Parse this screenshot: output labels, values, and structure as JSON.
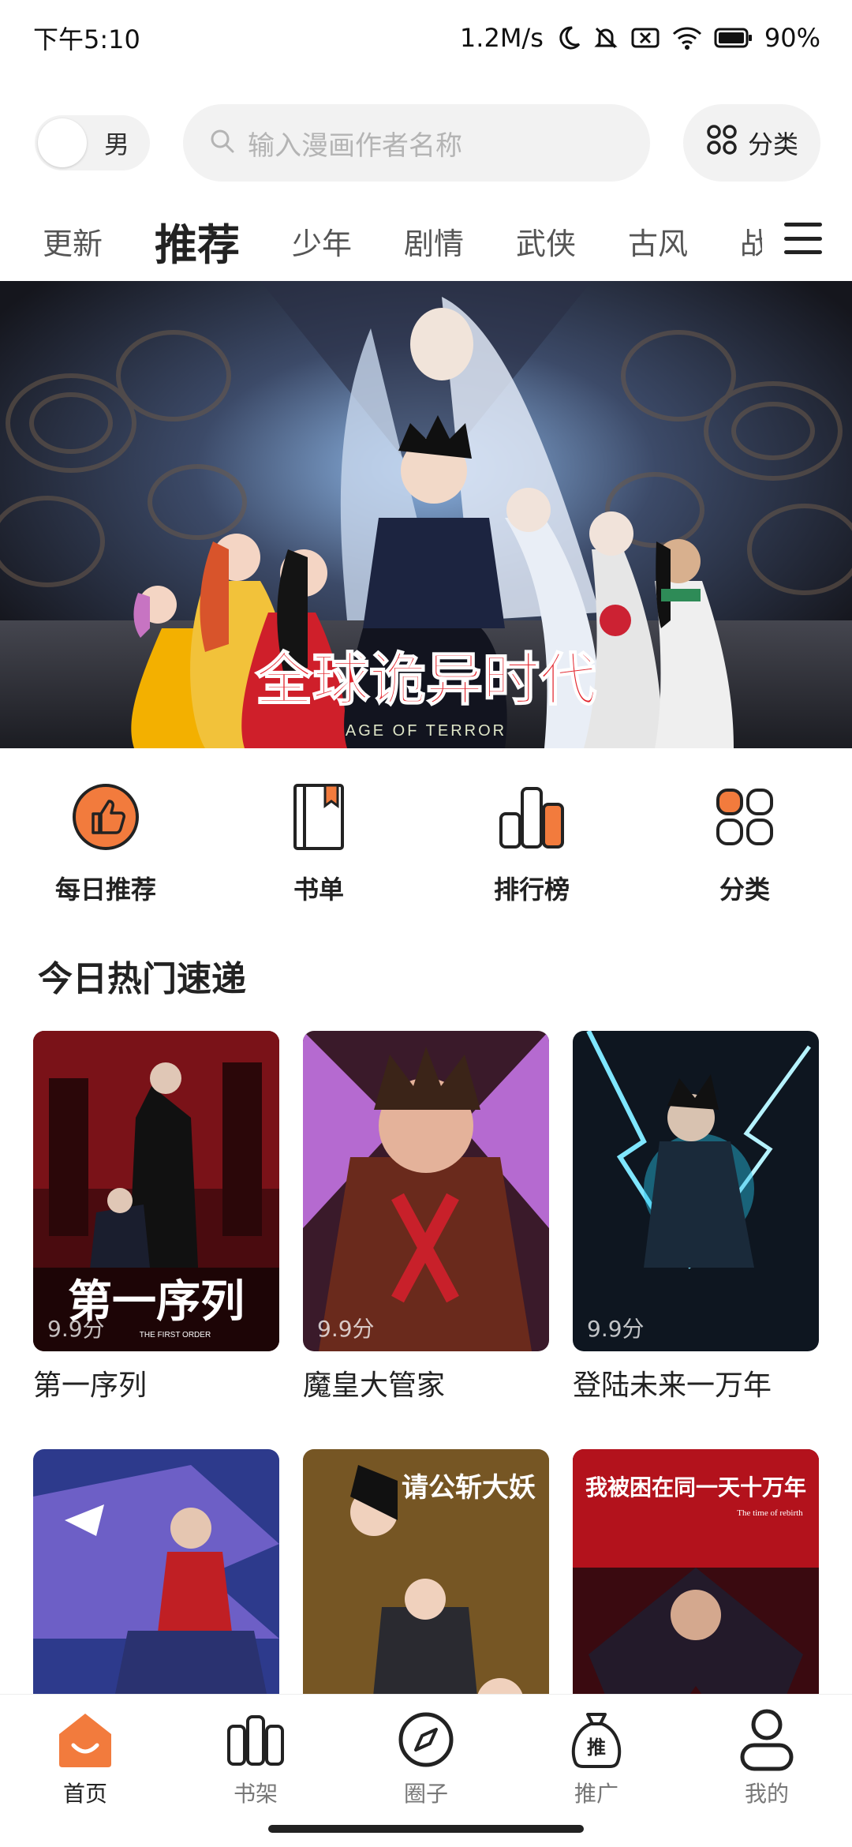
{
  "status_bar": {
    "time": "下午5:10",
    "net_speed": "1.2M/s",
    "battery": "90%"
  },
  "top_bar": {
    "gender_label": "男",
    "search_placeholder": "输入漫画作者名称",
    "category_label": "分类"
  },
  "tabs": [
    {
      "label": "更新",
      "active": false
    },
    {
      "label": "推荐",
      "active": true
    },
    {
      "label": "少年",
      "active": false
    },
    {
      "label": "剧情",
      "active": false
    },
    {
      "label": "武侠",
      "active": false
    },
    {
      "label": "古风",
      "active": false
    },
    {
      "label": "战",
      "active": false
    }
  ],
  "banner": {
    "title": "全球诡异时代",
    "subtitle": "AGE OF TERROR"
  },
  "quick_entries": [
    {
      "label": "每日推荐",
      "icon": "thumbs-up-icon"
    },
    {
      "label": "书单",
      "icon": "book-icon"
    },
    {
      "label": "排行榜",
      "icon": "ranking-icon"
    },
    {
      "label": "分类",
      "icon": "category-icon"
    }
  ],
  "section_title": "今日热门速递",
  "comics": [
    {
      "title": "第一序列",
      "score": "9.9分",
      "cover_text": "第一序列",
      "cover_sub": "THE FIRST ORDER"
    },
    {
      "title": "魔皇大管家",
      "score": "9.9分",
      "cover_text": "",
      "cover_sub": ""
    },
    {
      "title": "登陆未来一万年",
      "score": "9.9分",
      "cover_text": "",
      "cover_sub": ""
    },
    {
      "title": "",
      "score": "",
      "cover_text": "",
      "cover_sub": ""
    },
    {
      "title": "",
      "score": "",
      "cover_text": "请公斩大妖",
      "cover_sub": ""
    },
    {
      "title": "",
      "score": "",
      "cover_text": "我被困在同一天十万年",
      "cover_sub": "The time of rebirth"
    }
  ],
  "bottom_nav": [
    {
      "label": "首页",
      "icon": "home-icon",
      "active": true
    },
    {
      "label": "书架",
      "icon": "bookshelf-icon",
      "active": false
    },
    {
      "label": "圈子",
      "icon": "compass-icon",
      "active": false
    },
    {
      "label": "推广",
      "icon": "promote-bag-icon",
      "active": false
    },
    {
      "label": "我的",
      "icon": "profile-icon",
      "active": false
    }
  ],
  "colors": {
    "accent": "#f27b3d",
    "text": "#222222",
    "muted": "#b4b4b4",
    "pill_bg": "#f2f2f2"
  }
}
